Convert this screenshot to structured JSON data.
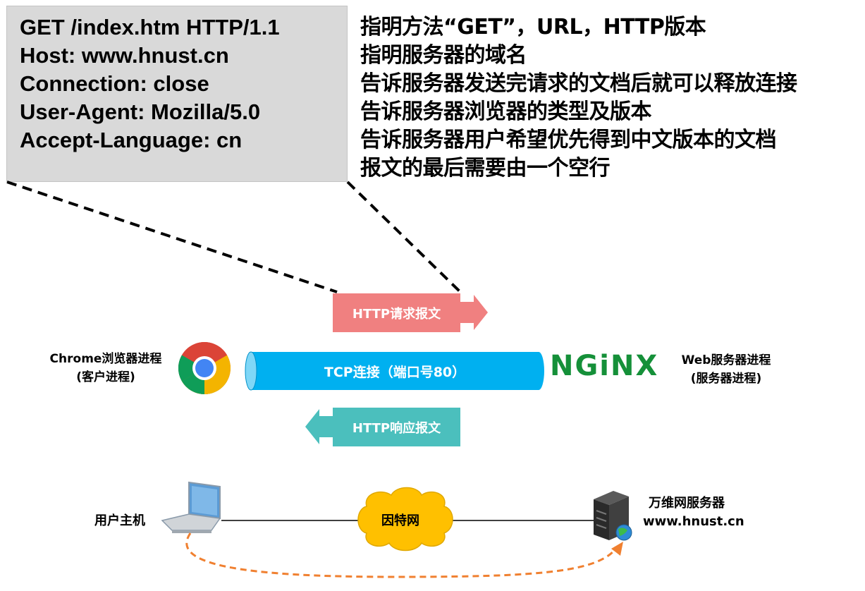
{
  "request_lines": [
    "GET /index.htm HTTP/1.1",
    "Host: www.hnust.cn",
    "Connection: close",
    "User-Agent: Mozilla/5.0",
    "Accept-Language: cn"
  ],
  "explanations": [
    "指明方法“GET”，URL，HTTP版本",
    "指明服务器的域名",
    "告诉服务器发送完请求的文档后就可以释放连接",
    "告诉服务器浏览器的类型及版本",
    "告诉服务器用户希望优先得到中文版本的文档",
    "报文的最后需要由一个空行"
  ],
  "request_message_label": "HTTP请求报文",
  "response_message_label": "HTTP响应报文",
  "tcp_label": "TCP连接（端口号80）",
  "client": {
    "line1": "Chrome浏览器进程",
    "line2": "(客户进程)"
  },
  "server": {
    "logo_text": "NGiNX",
    "line1": "Web服务器进程",
    "line2": "(服务器进程)"
  },
  "network": {
    "user_host": "用户主机",
    "internet": "因特网",
    "server_line1": "万维网服务器",
    "server_line2": "www.hnust.cn"
  },
  "colors": {
    "request_box": "#d9d9d9",
    "request_arrow": "#f08080",
    "response_arrow": "#4bbfbd",
    "tcp_pipe": "#00b0f0",
    "nginx_green": "#159039",
    "cloud": "#ffc000",
    "dashed_curve": "#f08030"
  }
}
